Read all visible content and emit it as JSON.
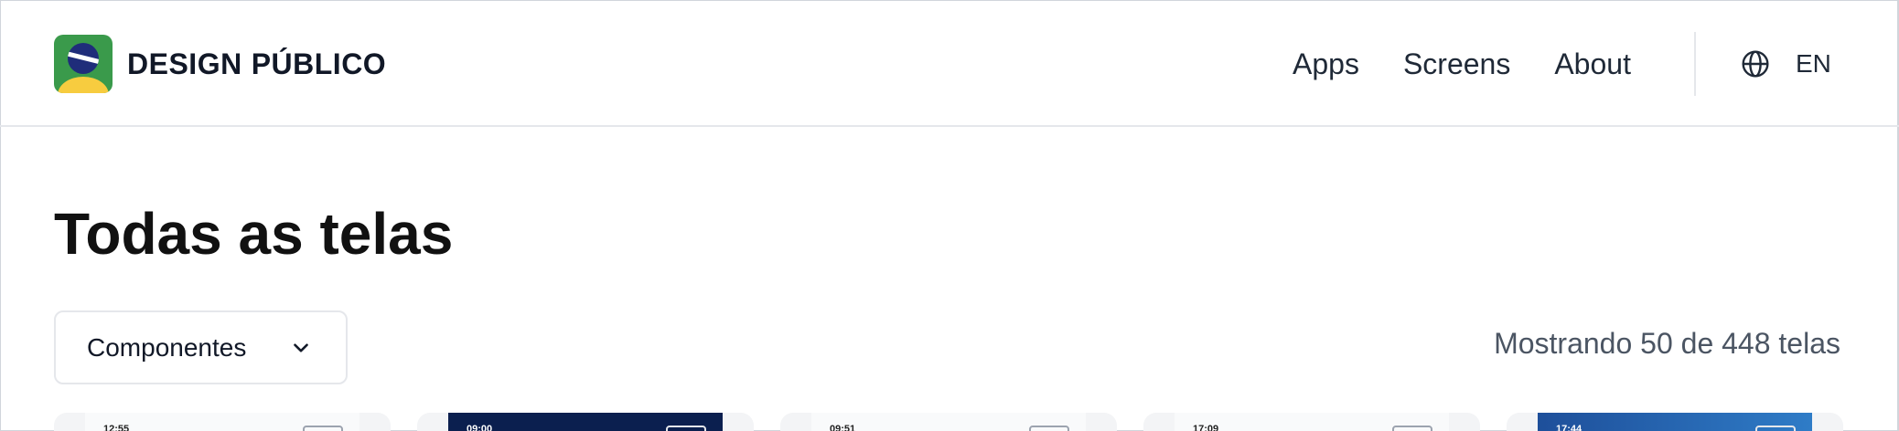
{
  "header": {
    "brand_bold": "DESIGN",
    "brand_regular": "PÚBLICO",
    "nav": [
      "Apps",
      "Screens",
      "About"
    ],
    "language": "EN",
    "logo_icon": "brazil-flag-logo",
    "language_icon": "globe-icon"
  },
  "main": {
    "title": "Todas as telas",
    "filter": {
      "selected": "Componentes",
      "icon": "chevron-down-icon"
    },
    "count": "Mostrando 50 de 448 telas",
    "cards": [
      {
        "time": "12:55",
        "theme": "light"
      },
      {
        "time": "09:00",
        "theme": "dark"
      },
      {
        "time": "09:51",
        "theme": "light"
      },
      {
        "time": "17:09",
        "theme": "light"
      },
      {
        "time": "17:44",
        "theme": "blue"
      }
    ]
  },
  "colors": {
    "brand_green": "#3a9a4b",
    "brand_yellow": "#f7cc3f",
    "brand_blue": "#1f2d7a",
    "muted_text": "#4b5563",
    "border": "#e5e7eb"
  }
}
